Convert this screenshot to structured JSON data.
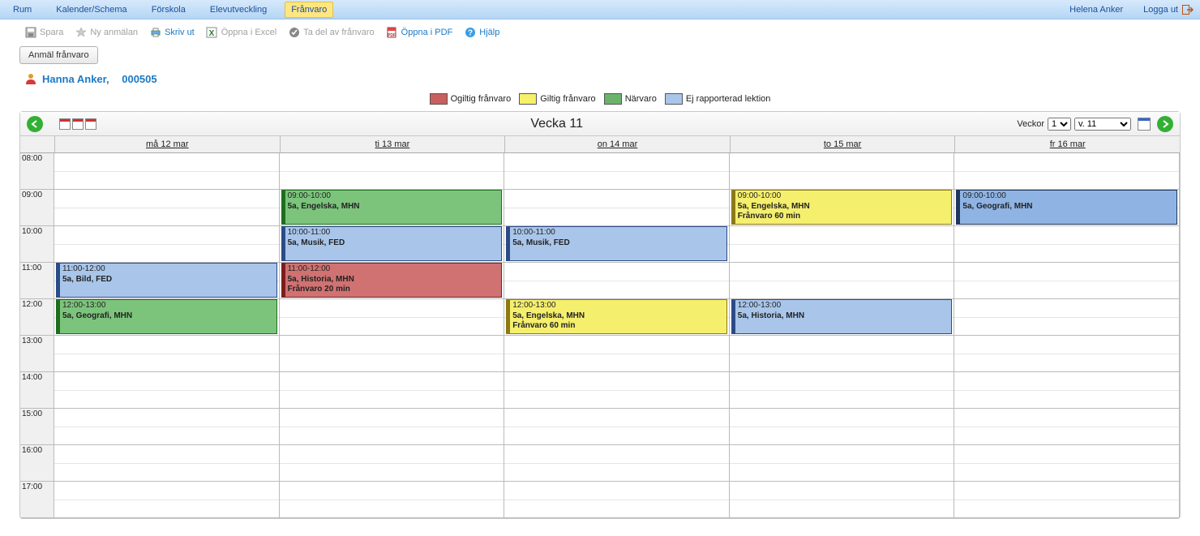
{
  "nav": {
    "items": [
      "Rum",
      "Kalender/Schema",
      "Förskola",
      "Elevutveckling",
      "Frånvaro"
    ],
    "activeIndex": 4,
    "user": "Helena Anker",
    "logout": "Logga ut"
  },
  "toolbar": {
    "save": "Spara",
    "new": "Ny anmälan",
    "print": "Skriv ut",
    "excel": "Öppna i Excel",
    "take": "Ta del av frånvaro",
    "pdf": "Öppna i PDF",
    "help": "Hjälp"
  },
  "actions": {
    "report": "Anmäl frånvaro"
  },
  "student": {
    "name": "Hanna Anker,",
    "id": "000505"
  },
  "legend": {
    "invalid": "Ogiltig frånvaro",
    "valid": "Giltig frånvaro",
    "present": "Närvaro",
    "unreported": "Ej rapporterad lektion"
  },
  "calendar": {
    "weekLabel": "Vecka 11",
    "weeksLabel": "Veckor",
    "weeksCount": "1",
    "weekSelect": "v. 11",
    "days": [
      "må 12 mar",
      "ti 13 mar",
      "on 14 mar",
      "to 15 mar",
      "fr 16 mar"
    ],
    "hours": [
      "08:00",
      "09:00",
      "10:00",
      "11:00",
      "12:00",
      "13:00",
      "14:00",
      "15:00",
      "16:00",
      "17:00"
    ],
    "events": [
      {
        "day": 0,
        "startHour": 11,
        "endHour": 12,
        "color": "blue",
        "time": "11:00-12:00",
        "detail": "5a, Bild, FED",
        "note": ""
      },
      {
        "day": 0,
        "startHour": 12,
        "endHour": 13,
        "color": "green",
        "time": "12:00-13:00",
        "detail": "5a, Geografi, MHN",
        "note": ""
      },
      {
        "day": 1,
        "startHour": 9,
        "endHour": 10,
        "color": "green",
        "time": "09:00-10:00",
        "detail": "5a, Engelska, MHN",
        "note": ""
      },
      {
        "day": 1,
        "startHour": 10,
        "endHour": 11,
        "color": "blue",
        "time": "10:00-11:00",
        "detail": "5a, Musik, FED",
        "note": ""
      },
      {
        "day": 1,
        "startHour": 11,
        "endHour": 12,
        "color": "red",
        "time": "11:00-12:00",
        "detail": "5a, Historia, MHN",
        "note": "Frånvaro 20 min"
      },
      {
        "day": 2,
        "startHour": 10,
        "endHour": 11,
        "color": "blue",
        "time": "10:00-11:00",
        "detail": "5a, Musik, FED",
        "note": ""
      },
      {
        "day": 2,
        "startHour": 12,
        "endHour": 13,
        "color": "yellow",
        "time": "12:00-13:00",
        "detail": "5a, Engelska, MHN",
        "note": "Frånvaro 60 min"
      },
      {
        "day": 3,
        "startHour": 9,
        "endHour": 10,
        "color": "yellow",
        "time": "09:00-10:00",
        "detail": "5a, Engelska, MHN",
        "note": "Frånvaro 60 min"
      },
      {
        "day": 3,
        "startHour": 12,
        "endHour": 13,
        "color": "blue",
        "time": "12:00-13:00",
        "detail": "5a, Historia, MHN",
        "note": ""
      },
      {
        "day": 4,
        "startHour": 9,
        "endHour": 10,
        "color": "blue-dark",
        "time": "09:00-10:00",
        "detail": "5a, Geografi, MHN",
        "note": ""
      }
    ]
  }
}
